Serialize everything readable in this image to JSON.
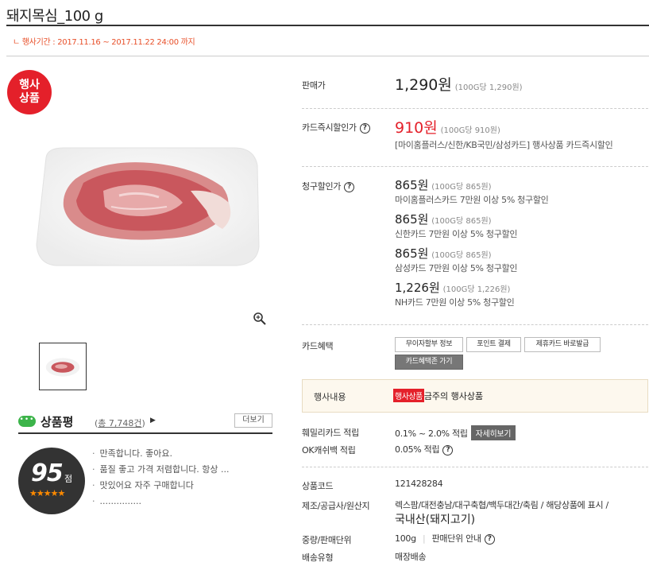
{
  "product": {
    "title": "돼지목심_100 g",
    "period": "ㄴ 행사기간 : 2017.11.16 ~ 2017.11.22 24:00 까지",
    "badge_line1": "행사",
    "badge_line2": "상품"
  },
  "price": {
    "label": "판매가",
    "value": "1,290원",
    "unit": "(100G당 1,290원)"
  },
  "card_discount": {
    "label": "카드즉시할인가",
    "value": "910원",
    "unit": "(100G당 910원)",
    "desc": "[마이홈플러스/신한/KB국민/삼성카드] 행사상품 카드즉시할인"
  },
  "bill_discount": {
    "label": "청구할인가",
    "items": [
      {
        "value": "865원",
        "unit": "(100G당 865원)",
        "desc": "마이홈플러스카드 7만원 이상 5% 청구할인"
      },
      {
        "value": "865원",
        "unit": "(100G당 865원)",
        "desc": "신한카드 7만원 이상 5% 청구할인"
      },
      {
        "value": "865원",
        "unit": "(100G당 865원)",
        "desc": "삼성카드 7만원 이상 5% 청구할인"
      },
      {
        "value": "1,226원",
        "unit": "(100G당 1,226원)",
        "desc": "NH카드 7만원 이상 5% 청구할인"
      }
    ]
  },
  "card_benefit": {
    "label": "카드혜택",
    "buttons": [
      "무이자할부 정보",
      "포인트 결제",
      "제휴카드 바로발급"
    ],
    "zone_button": "카드혜택존 가기"
  },
  "event": {
    "label": "행사내용",
    "tag": "행사상품",
    "text": "금주의 행사상품"
  },
  "points": {
    "family_label": "훼밀리카드 적립",
    "family_value": "0.1% ~ 2.0% 적립",
    "family_button": "자세히보기",
    "ok_label": "OK캐쉬백 적립",
    "ok_value": "0.05% 적립"
  },
  "info": {
    "code_label": "상품코드",
    "code_value": "121428284",
    "maker_label": "제조/공급사/원산지",
    "maker_value": "렉스팜/대전충남/대구축협/백두대간/축림 / 해당상품에 표시 /",
    "origin_value": "국내산(돼지고기)",
    "weight_label": "중량/판매단위",
    "weight_value": "100g",
    "unit_info": "판매단위 안내",
    "delivery_label": "배송유형",
    "delivery_value": "매장배송"
  },
  "review": {
    "title": "상품평",
    "count_prefix": "(",
    "count": "총 7,748건",
    "count_suffix": ")",
    "more": "더보기",
    "score": "95",
    "score_unit": "점",
    "stars": "★★★★★",
    "items": [
      "만족합니다. 좋아요.",
      "품질 좋고 가격 저렴합니다. 항상 ...",
      "맛있어요 자주 구매합니다",
      "..............."
    ]
  },
  "colors": {
    "accent_red": "#e4202a",
    "period_orange": "#e8502a",
    "review_green": "#3cb44a",
    "star_orange": "#ff8a00"
  }
}
